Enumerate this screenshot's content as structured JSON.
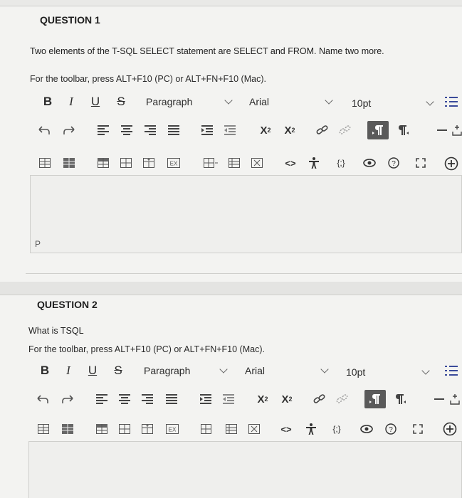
{
  "q1": {
    "title": "QUESTION 1",
    "prompt": "Two elements of the T-SQL SELECT statement are SELECT and FROM. Name two more.",
    "toolbar_hint": "For the toolbar, press ALT+F10 (PC) or ALT+FN+F10 (Mac).",
    "paragraph_select": "Paragraph",
    "font_select": "Arial",
    "size_select": "10pt",
    "status_path": "P"
  },
  "q2": {
    "title": "QUESTION 2",
    "prompt": "What is TSQL",
    "toolbar_hint": "For the toolbar, press ALT+F10 (PC) or ALT+FN+F10 (Mac).",
    "paragraph_select": "Paragraph",
    "font_select": "Arial",
    "size_select": "10pt"
  },
  "toolbar": {
    "bold": "B",
    "italic": "I",
    "underline": "U",
    "strike": "S",
    "superscript_base": "X",
    "superscript_mark": "2",
    "subscript_base": "X",
    "subscript_mark": "2",
    "code": "<>",
    "braces": "{;}",
    "icons": [
      "undo-icon",
      "redo-icon",
      "align-left-icon",
      "align-center-icon",
      "align-right-icon",
      "align-justify-icon",
      "bullet-list-icon",
      "numbered-list-icon",
      "link-icon",
      "unlink-icon",
      "ltr-icon",
      "rtl-icon",
      "horizontal-line-icon",
      "table-icon",
      "accessibility-icon",
      "preview-icon",
      "help-icon",
      "fullscreen-icon",
      "add-content-icon"
    ]
  },
  "colors": {
    "page_bg": "#e9e9e7",
    "panel_bg": "#f3f3f1",
    "text": "#1e1e1e",
    "active_btn": "#5a5a5a"
  }
}
